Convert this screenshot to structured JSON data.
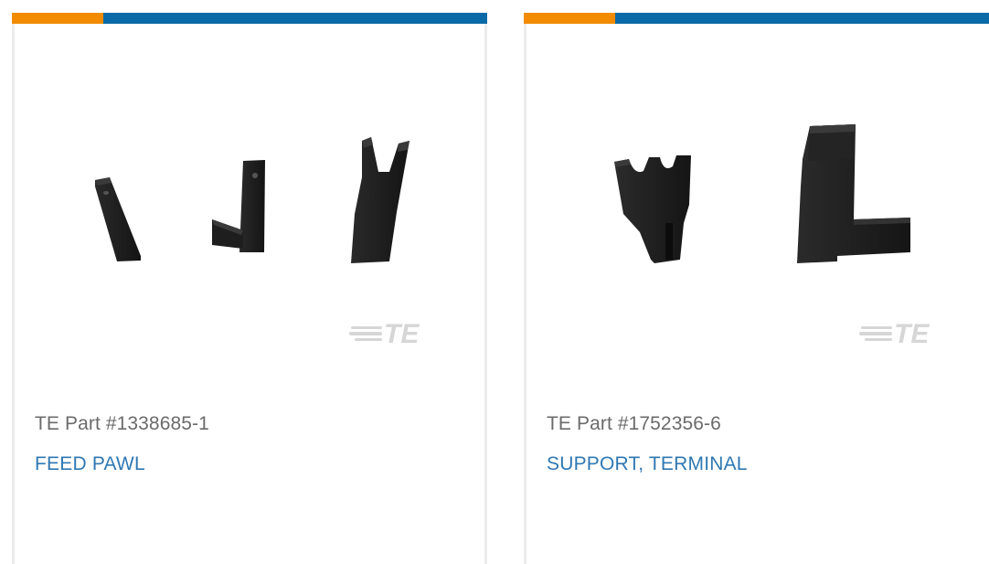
{
  "colors": {
    "accent_orange": "#f28b00",
    "accent_blue": "#0a6aa8",
    "link_blue": "#2f78b3",
    "part_gray": "#6b6b6b",
    "logo_gray": "#d6d6d6"
  },
  "cards": [
    {
      "part_number": "TE Part #1338685-1",
      "name": "FEED PAWL",
      "image_icon": "feed-pawl-3d-render",
      "logo_text": "TE"
    },
    {
      "part_number": "TE Part #1752356-6",
      "name": "SUPPORT, TERMINAL",
      "image_icon": "terminal-support-3d-render",
      "logo_text": "TE"
    }
  ]
}
